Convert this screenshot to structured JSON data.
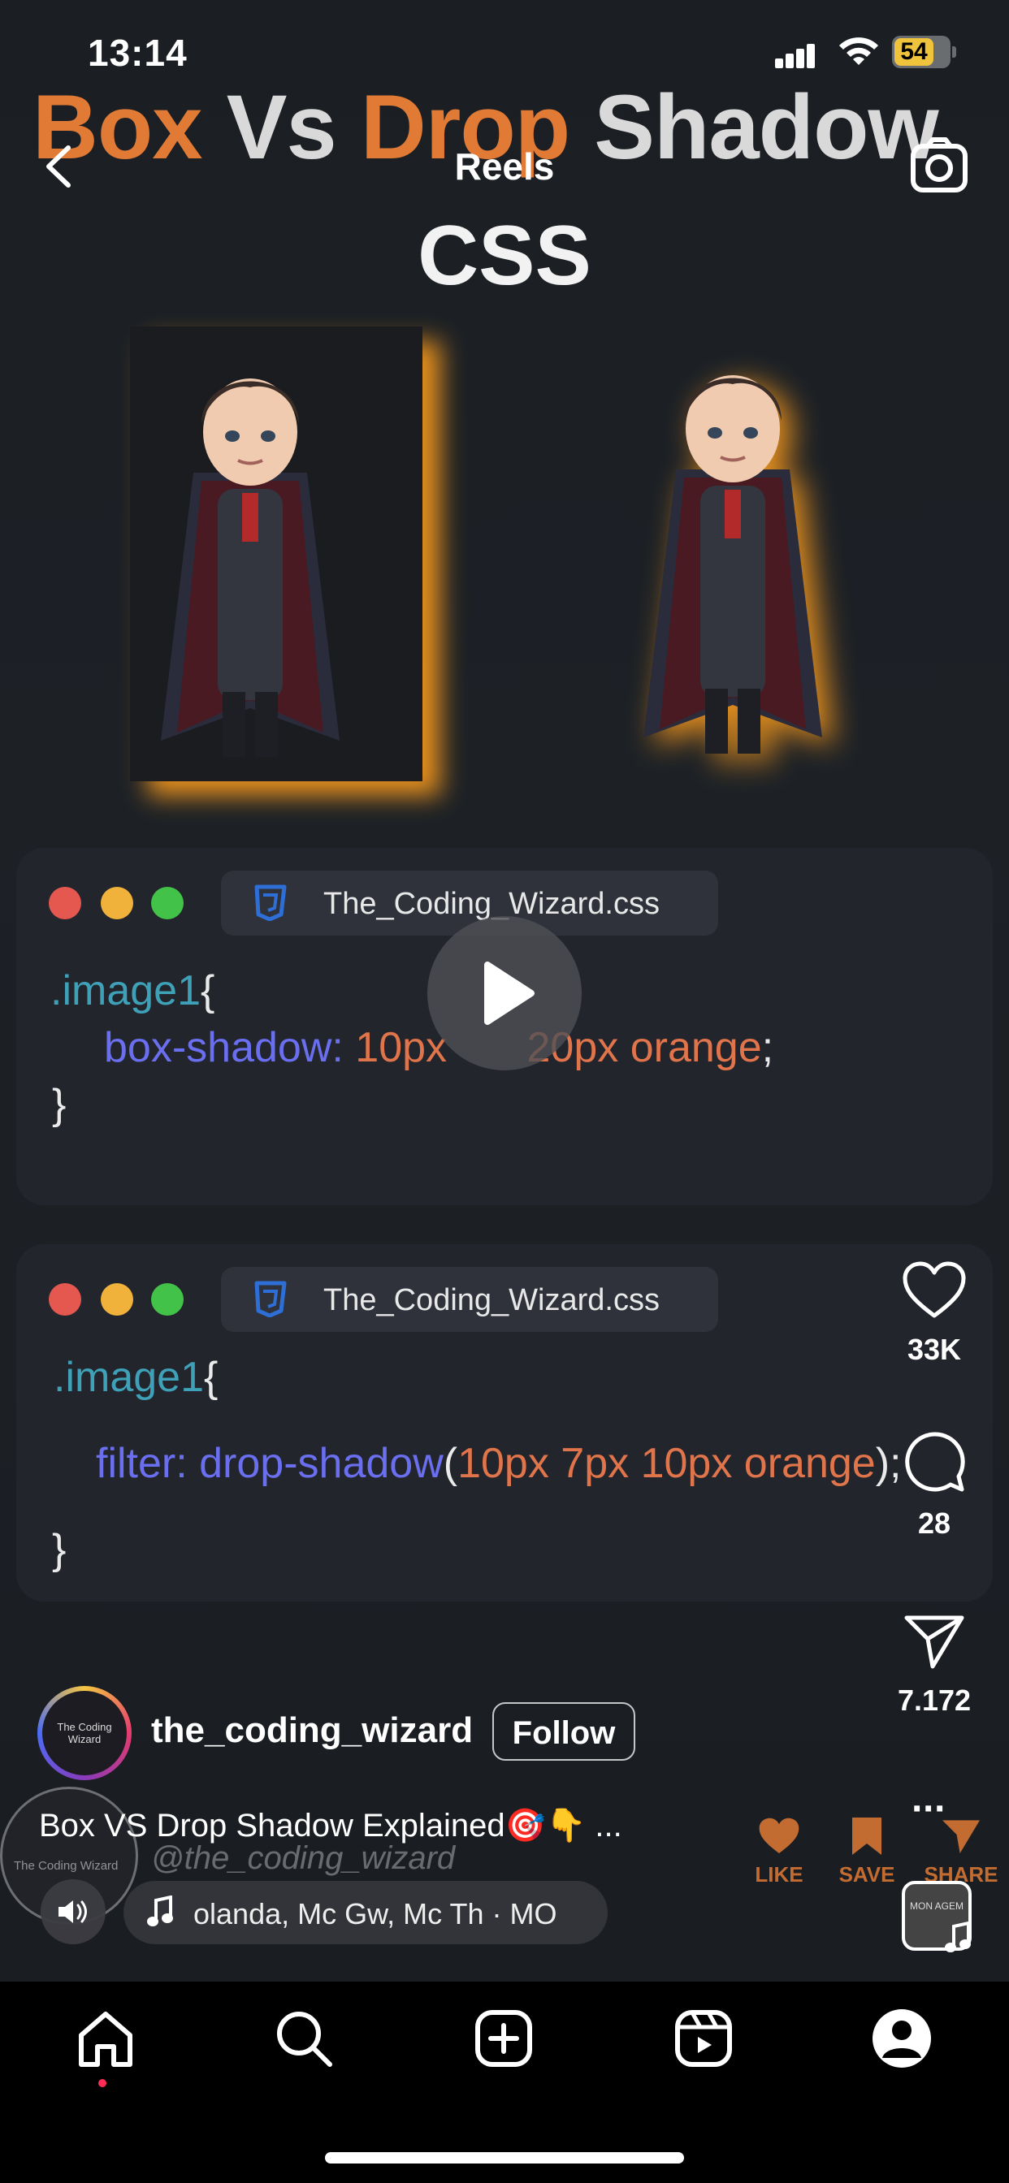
{
  "status_bar": {
    "time": "13:14",
    "battery": "54"
  },
  "header": {
    "title": "Reels"
  },
  "video": {
    "title_part1": "Box",
    "title_part2": "Vs",
    "title_part3": "Drop",
    "title_part4": "Shadow",
    "title_line2": "CSS",
    "card1": {
      "filename": "The_Coding_Wizard.css",
      "selector": ".image1",
      "open_brace": "{",
      "property": "box-shadow:",
      "value_a": "10px",
      "value_b": "20px",
      "value_c": "orange",
      "semicolon": ";",
      "close_brace": "}"
    },
    "card2": {
      "filename": "The_Coding_Wizard.css",
      "selector": ".image1",
      "open_brace": "{",
      "property": "filter:",
      "func": "drop-shadow",
      "paren": "(",
      "value": "10px 7px 10px orange",
      "close_paren": ");",
      "close_brace": "}"
    }
  },
  "rail": {
    "likes": "33K",
    "comments": "28",
    "shares": "7.172",
    "more": "···"
  },
  "post": {
    "username": "the_coding_wizard",
    "follow_label": "Follow",
    "caption": "Box VS Drop Shadow Explained🎯👇  ...",
    "handle_watermark": "@the_coding_wizard",
    "logo_text": "The Coding Wizard",
    "ghost_like": "LIKE",
    "ghost_save": "SAVE",
    "ghost_share": "SHARE",
    "music": "olanda, Mc Gw, Mc Th · MO",
    "audio_thumb_text": "MON AGEM"
  },
  "colors": {
    "accent_orange": "#e07a35",
    "shadow_orange": "#f0961e",
    "notification_red": "#ff2d55"
  },
  "nav": [
    "home-icon",
    "search-icon",
    "create-icon",
    "reels-icon",
    "profile-icon"
  ]
}
